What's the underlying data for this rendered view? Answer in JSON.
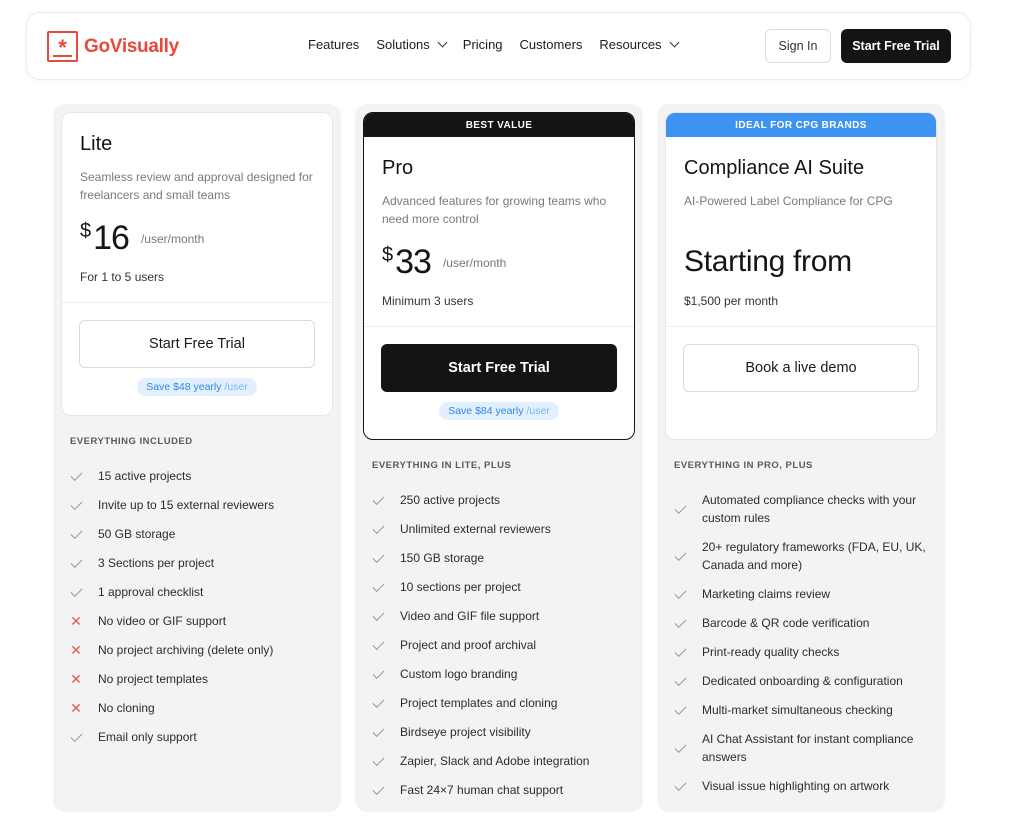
{
  "nav": {
    "logo_text": "GoVisually",
    "links": [
      {
        "label": "Features",
        "has_dropdown": false
      },
      {
        "label": "Solutions",
        "has_dropdown": true
      },
      {
        "label": "Pricing",
        "has_dropdown": false
      },
      {
        "label": "Customers",
        "has_dropdown": false
      },
      {
        "label": "Resources",
        "has_dropdown": true
      }
    ],
    "sign_in": "Sign In",
    "start_trial": "Start Free Trial"
  },
  "plans": {
    "lite": {
      "name": "Lite",
      "description": "Seamless review and approval designed for freelancers and small teams",
      "currency": "$",
      "price": "16",
      "per": "/user/month",
      "note": "For 1 to 5 users",
      "cta": "Start Free Trial",
      "save_main": "Save $48 yearly",
      "save_unit": " /user",
      "features_heading": "EVERYTHING INCLUDED",
      "features": [
        {
          "text": "15 active projects",
          "included": true
        },
        {
          "text": "Invite up to 15 external reviewers",
          "included": true
        },
        {
          "text": "50 GB storage",
          "included": true
        },
        {
          "text": "3 Sections per project",
          "included": true
        },
        {
          "text": "1 approval checklist",
          "included": true
        },
        {
          "text": "No video or GIF support",
          "included": false
        },
        {
          "text": "No project archiving (delete only)",
          "included": false
        },
        {
          "text": "No project templates",
          "included": false
        },
        {
          "text": "No cloning",
          "included": false
        },
        {
          "text": "Email only support",
          "included": true
        }
      ]
    },
    "pro": {
      "banner": "BEST VALUE",
      "banner_color": "#141414",
      "name": "Pro",
      "description": "Advanced features for growing teams who need more control",
      "currency": "$",
      "price": "33",
      "per": "/user/month",
      "note": "Minimum 3 users",
      "cta": "Start Free Trial",
      "save_main": "Save $84 yearly",
      "save_unit": " /user",
      "features_heading": "EVERYTHING IN LITE, PLUS",
      "features": [
        {
          "text": "250 active projects",
          "included": true
        },
        {
          "text": "Unlimited external reviewers",
          "included": true
        },
        {
          "text": "150 GB storage",
          "included": true
        },
        {
          "text": "10 sections per project",
          "included": true
        },
        {
          "text": "Video and GIF file support",
          "included": true
        },
        {
          "text": "Project and proof archival",
          "included": true
        },
        {
          "text": "Custom logo branding",
          "included": true
        },
        {
          "text": "Project templates and cloning",
          "included": true
        },
        {
          "text": "Birdseye project visibility",
          "included": true
        },
        {
          "text": "Zapier, Slack and Adobe integration",
          "included": true
        },
        {
          "text": "Fast 24×7 human chat support",
          "included": true
        }
      ]
    },
    "compliance": {
      "banner": "IDEAL FOR CPG BRANDS",
      "banner_color": "#3d93f2",
      "name": "Compliance AI Suite",
      "description": "AI-Powered Label Compliance for CPG",
      "price_text": "Starting from",
      "note": "$1,500 per month",
      "cta": "Book a live demo",
      "features_heading": "EVERYTHING IN PRO, PLUS",
      "features": [
        {
          "text": "Automated compliance checks with your custom rules",
          "included": true
        },
        {
          "text": "20+ regulatory frameworks (FDA, EU, UK, Canada and more)",
          "included": true
        },
        {
          "text": "Marketing claims review",
          "included": true
        },
        {
          "text": "Barcode & QR code verification",
          "included": true
        },
        {
          "text": "Print-ready quality checks",
          "included": true
        },
        {
          "text": "Dedicated onboarding & configuration",
          "included": true
        },
        {
          "text": "Multi-market simultaneous checking",
          "included": true
        },
        {
          "text": "AI Chat Assistant for instant compliance answers",
          "included": true
        },
        {
          "text": "Visual issue highlighting on artwork",
          "included": true
        }
      ]
    }
  },
  "colors": {
    "brand": "#e8493b",
    "dark_button": "#141414",
    "save_badge_bg": "#e1efff",
    "save_badge_text": "#2e89ea",
    "cross": "#e8574a"
  }
}
